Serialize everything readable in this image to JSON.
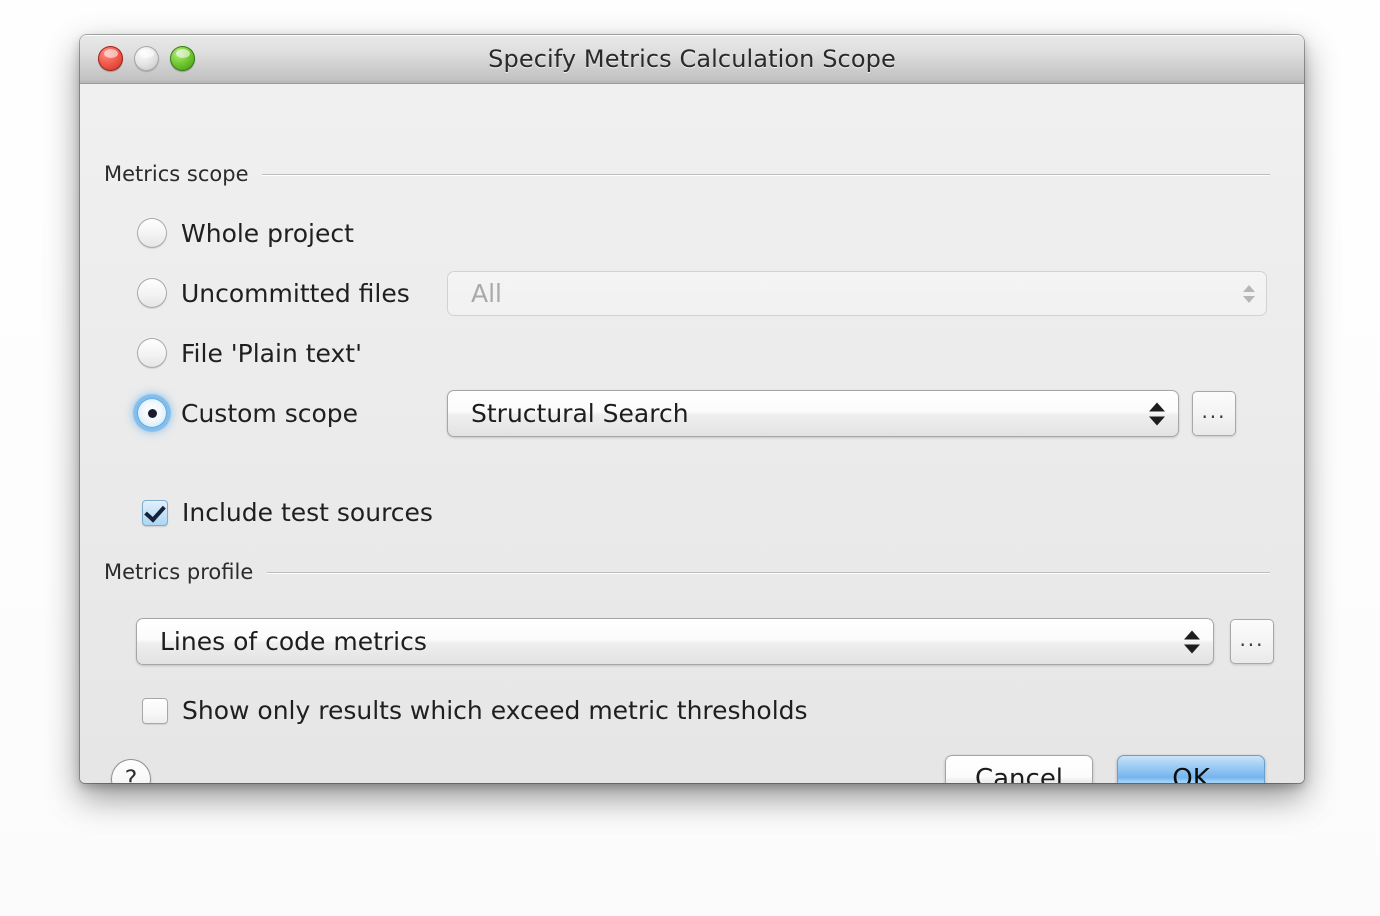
{
  "window": {
    "title": "Specify Metrics Calculation Scope",
    "traffic_lights": [
      "close-button",
      "minimize-button",
      "zoom-button"
    ]
  },
  "scope_group": {
    "label": "Metrics scope",
    "options": [
      {
        "label": "Whole project",
        "selected": false
      },
      {
        "label": "Uncommitted files",
        "selected": false
      },
      {
        "label": "File 'Plain text'",
        "selected": false
      },
      {
        "label": "Custom scope",
        "selected": true
      }
    ],
    "uncommitted_combo": {
      "value": "All",
      "enabled": false
    },
    "custom_combo": {
      "value": "Structural Search",
      "enabled": true
    },
    "custom_browse_label": "...",
    "include_test_sources": {
      "label": "Include test sources",
      "checked": true
    }
  },
  "profile_group": {
    "label": "Metrics profile",
    "combo": {
      "value": "Lines of code metrics"
    },
    "browse_label": "...",
    "threshold_option": {
      "label": "Show only results which exceed metric thresholds",
      "checked": false
    }
  },
  "footer": {
    "help_label": "?",
    "cancel_label": "Cancel",
    "ok_label": "OK"
  }
}
